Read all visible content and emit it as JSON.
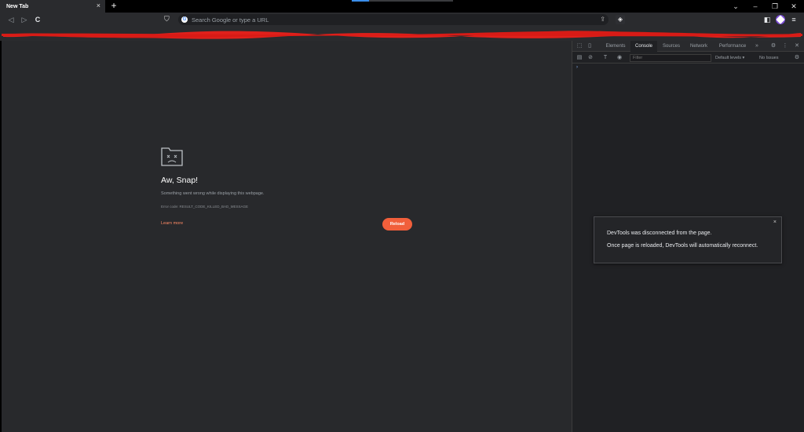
{
  "tabs": [
    {
      "title": "New Tab",
      "close": "×"
    }
  ],
  "tabstrip": {
    "new_tab": "+",
    "minimize": "–",
    "restore": "❐",
    "close": "✕",
    "tab_search": "⌄",
    "loading_progress": 0.17
  },
  "toolbar": {
    "back": "◁",
    "forward": "▷",
    "reload": "C",
    "omnibox_placeholder": "Search Google or type a URL",
    "google_icon": "G",
    "share_icon": "⇪",
    "bookmark_icon": "⛉",
    "brave_icon": "◈",
    "sidebar_icon": "◧",
    "menu_icon": "≡"
  },
  "page": {
    "title": "Aw, Snap!",
    "description": "Something went wrong while displaying this webpage.",
    "error_code": "Error code: RESULT_CODE_KILLED_BAD_MESSAGE",
    "learn_more": "Learn more",
    "reload_label": "Reload"
  },
  "devtools": {
    "tabs": [
      {
        "label": "Elements"
      },
      {
        "label": "Console",
        "active": true
      },
      {
        "label": "Sources"
      },
      {
        "label": "Network"
      },
      {
        "label": "Performance"
      }
    ],
    "more_tabs": "»",
    "settings": "⚙",
    "kebab": "⋮",
    "close": "✕",
    "inspect_icon": "⬚",
    "device_icon": "▯",
    "sidebar_toggle": "▤",
    "clear_icon": "⊘",
    "context": "T",
    "eye_icon": "◉",
    "filter_placeholder": "Filter",
    "levels": "Default levels ▾",
    "issues": "No Issues",
    "prompt": "›",
    "toast": {
      "close": "×",
      "line1": "DevTools was disconnected from the page.",
      "line2": "Once page is reloaded, DevTools will automatically reconnect."
    }
  },
  "colors": {
    "accent": "#f15f3b",
    "link": "#ff8a65",
    "redaction": "#e0201b"
  }
}
